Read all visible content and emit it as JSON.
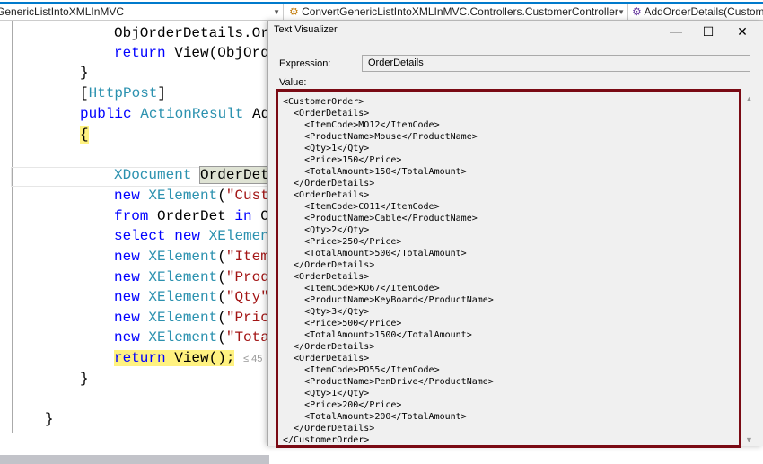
{
  "nav": {
    "project": "GenericListIntoXMLInMVC",
    "class": "ConvertGenericListIntoXMLInMVC.Controllers.CustomerController",
    "member": "AddOrderDetails(CustomerO"
  },
  "code": {
    "l1": "ObjOrderDetails.Or",
    "l2a": "return",
    "l2b": " View(ObjOrd",
    "l3": "}",
    "l4a": "[",
    "l4b": "HttpPost",
    "l4c": "]",
    "l5a": "public",
    "l5b": "ActionResult",
    "l5c": " Ad",
    "l6": "{",
    "l7a": "XDocument",
    "l7b": "OrderDet",
    "l8a": "new",
    "l8b": "XElement",
    "l8c": "(",
    "l8d": "\"Cust",
    "l9a": "from",
    "l9b": " OrderDet ",
    "l9c": "in",
    "l9d": " O",
    "l10a": "select",
    "l10b": "new",
    "l10c": "XElemen",
    "l11d": "\"Item",
    "l12d": "\"Prod",
    "l13d": "\"Qty\"",
    "l14d": "\"Pric",
    "l15d": "\"Tota",
    "new": "new",
    "xel": "XElement",
    "paren": "(",
    "l16a": "return",
    "l16b": " View();",
    "hint": "≤ 45",
    "l17": "}",
    "l18": "}"
  },
  "dialog": {
    "title": "Text Visualizer",
    "minimize": "—",
    "maximize": "☐",
    "close": "✕",
    "expression_label": "Expression:",
    "expression_value": "OrderDetails",
    "value_label": "Value:",
    "value": "<CustomerOrder>\n  <OrderDetails>\n    <ItemCode>MO12</ItemCode>\n    <ProductName>Mouse</ProductName>\n    <Qty>1</Qty>\n    <Price>150</Price>\n    <TotalAmount>150</TotalAmount>\n  </OrderDetails>\n  <OrderDetails>\n    <ItemCode>CO11</ItemCode>\n    <ProductName>Cable</ProductName>\n    <Qty>2</Qty>\n    <Price>250</Price>\n    <TotalAmount>500</TotalAmount>\n  </OrderDetails>\n  <OrderDetails>\n    <ItemCode>KO67</ItemCode>\n    <ProductName>KeyBoard</ProductName>\n    <Qty>3</Qty>\n    <Price>500</Price>\n    <TotalAmount>1500</TotalAmount>\n  </OrderDetails>\n  <OrderDetails>\n    <ItemCode>PO55</ItemCode>\n    <ProductName>PenDrive</ProductName>\n    <Qty>1</Qty>\n    <Price>200</Price>\n    <TotalAmount>200</TotalAmount>\n  </OrderDetails>\n</CustomerOrder>"
  }
}
